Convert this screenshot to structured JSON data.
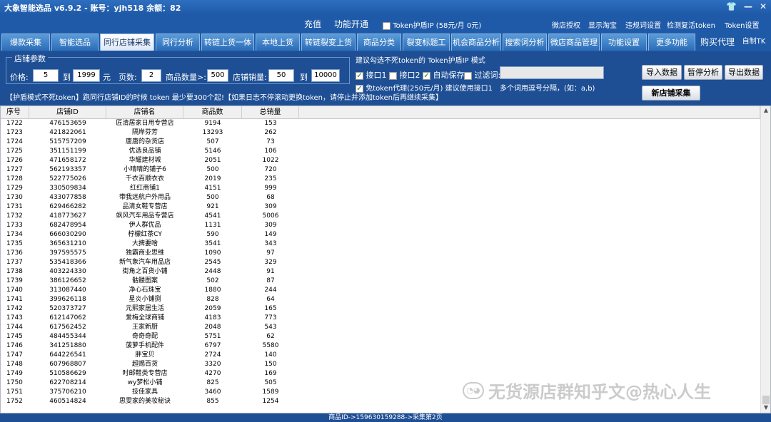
{
  "title": "大象智能选品 v6.9.2 - 账号：yjh518 余额：82",
  "topbar": {
    "recharge": "充值",
    "feature_open": "功能开通",
    "token_ip": "Token护盾IP (58元/月 0元)",
    "links": [
      "微店授权",
      "显示淘宝",
      "违规词设置",
      "检测复活token",
      "Token设置"
    ]
  },
  "tabs": [
    "爆款采集",
    "智能选品",
    "同行店铺采集",
    "同行分析",
    "转链上货一体",
    "本地上货",
    "转链裂变上货",
    "商品分类",
    "裂变标题工具",
    "机会商品分析",
    "搜索词分析",
    "微店商品管理",
    "功能设置",
    "更多功能"
  ],
  "tab_extra": [
    "购买代理",
    "自制TK"
  ],
  "params": {
    "group_label": "店铺参数",
    "price_label": "价格:",
    "price_from": "5",
    "to1": "到",
    "price_to": "1999",
    "yuan": "元",
    "pages_label": "页数:",
    "pages": "2",
    "goods_count_label": "商品数量>:",
    "goods_count": "500",
    "sales_label": "店铺销量:",
    "sales_from": "50",
    "to2": "到",
    "sales_to": "10000"
  },
  "options": {
    "suggest": "建议勾选不死token的  Token护盾IP 模式",
    "port1": "接口1",
    "port2": "接口2",
    "autosave": "自动保存",
    "filter": "过滤词:",
    "proxy": "免token代理(250元/月) 建议使用接口1",
    "multi": "多个词用逗号分隔，(如：a,b)"
  },
  "buttons": {
    "import": "导入数据",
    "pause": "暂停分析",
    "export": "导出数据",
    "new_collect": "新店铺采集"
  },
  "hint": "【护盾模式不死token】跑同行店铺ID的时候 token 最少要300个起!【如果日志不停滚动更换token，请停止并添加token后再继续采集】",
  "columns": [
    "序号",
    "店铺ID",
    "店铺名",
    "商品数",
    "总销量"
  ],
  "rows": [
    [
      "1722",
      "476153659",
      "匠清居家日用专营店",
      "9194",
      "153"
    ],
    [
      "1723",
      "421822061",
      "隔岸芬芳",
      "13293",
      "262"
    ],
    [
      "1724",
      "515757209",
      "唐唐的杂货店",
      "507",
      "73"
    ],
    [
      "1725",
      "351151199",
      "优选良品铺",
      "5146",
      "106"
    ],
    [
      "1726",
      "471658172",
      "华耀建材城",
      "2051",
      "1022"
    ],
    [
      "1727",
      "562193357",
      "小晴晴的铺子6",
      "500",
      "720"
    ],
    [
      "1728",
      "522775026",
      "千衣百顺衣衣",
      "2019",
      "235"
    ],
    [
      "1729",
      "330509834",
      "红红商铺1",
      "4151",
      "999"
    ],
    [
      "1730",
      "433077858",
      "带我远航户外用品",
      "500",
      "68"
    ],
    [
      "1731",
      "629466282",
      "品清女鞋专营店",
      "921",
      "309"
    ],
    [
      "1732",
      "418773627",
      "飒风汽车用品专营店",
      "4541",
      "5006"
    ],
    [
      "1733",
      "682478954",
      "伊人群优品",
      "1131",
      "309"
    ],
    [
      "1734",
      "666030290",
      "柠檬红茶CY",
      "590",
      "149"
    ],
    [
      "1735",
      "365631210",
      "大捭要啥",
      "3541",
      "343"
    ],
    [
      "1736",
      "397595575",
      "独霸商业思维",
      "1090",
      "97"
    ],
    [
      "1737",
      "535418366",
      "新气象汽车用品店",
      "2545",
      "329"
    ],
    [
      "1738",
      "403224330",
      "街角之百货小铺",
      "2448",
      "91"
    ],
    [
      "1739",
      "386126652",
      "骷髅图案",
      "502",
      "87"
    ],
    [
      "1740",
      "313087440",
      "净心石珠宝",
      "1880",
      "244"
    ],
    [
      "1741",
      "399626118",
      "星炎小铺捌",
      "828",
      "64"
    ],
    [
      "1742",
      "520373727",
      "元熙家居生活",
      "2059",
      "165"
    ],
    [
      "1743",
      "612147062",
      "爱梅全球商铺",
      "4183",
      "773"
    ],
    [
      "1744",
      "617562452",
      "王家新厨",
      "2048",
      "543"
    ],
    [
      "1745",
      "484455344",
      "奇奇奇配",
      "5751",
      "62"
    ],
    [
      "1746",
      "341251880",
      "菠萝手机配件",
      "6797",
      "5580"
    ],
    [
      "1747",
      "644226541",
      "胖宝贝",
      "2724",
      "140"
    ],
    [
      "1748",
      "607968807",
      "超赐百货",
      "3320",
      "150"
    ],
    [
      "1749",
      "510586629",
      "时邮鞋类专营店",
      "4270",
      "169"
    ],
    [
      "1750",
      "622708214",
      "wy梦松小铺",
      "825",
      "505"
    ],
    [
      "1751",
      "375706210",
      "技佳家具",
      "3460",
      "1589"
    ],
    [
      "1752",
      "460514824",
      "思雯家的美妆秘诀",
      "855",
      "1254"
    ]
  ],
  "status": "商品ID->159630159288->采集第2页",
  "watermark": "无货源店群知乎文@热心人生"
}
